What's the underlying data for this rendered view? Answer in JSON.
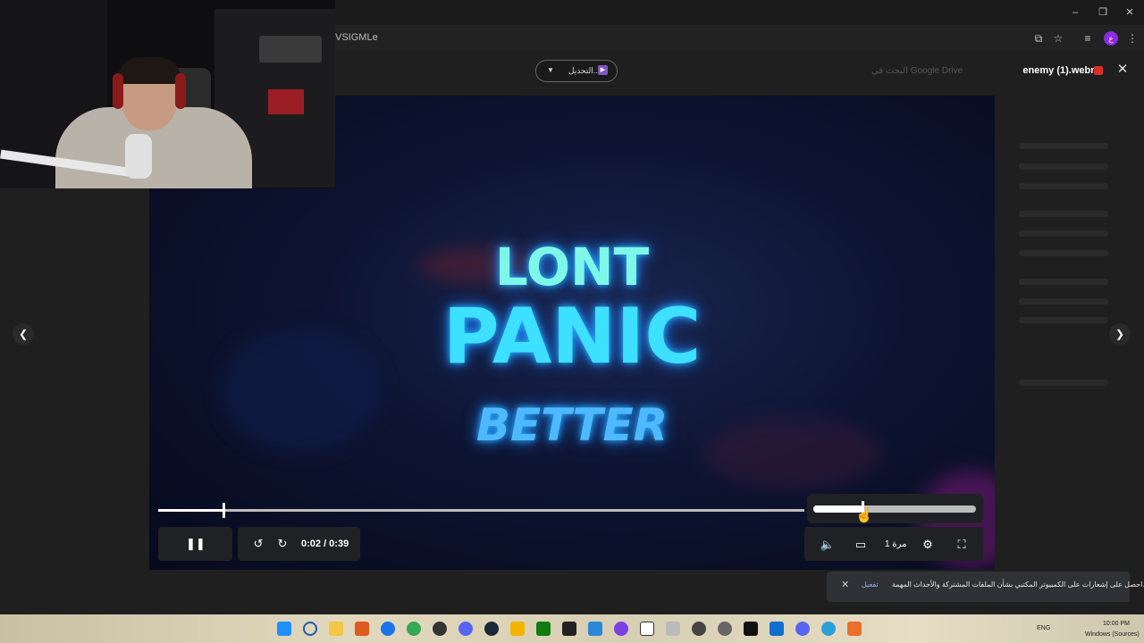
{
  "browser": {
    "address_fragment": "VSIGMLe",
    "profile_initial": "ع",
    "window_controls": [
      "minimize",
      "restore",
      "close"
    ]
  },
  "viewer": {
    "file_name": "enemy (1).webm",
    "open_with_label": "التحديل...",
    "search_placeholder": "البحث في Google Drive",
    "prev_icon": "chevron-left-icon",
    "next_icon": "chevron-right-icon"
  },
  "video": {
    "line1": "LONT",
    "line2": "PANIC",
    "line3": "BETTER"
  },
  "player": {
    "current_time": "0:02",
    "duration": "0:39",
    "time_label": "0:02 / 0:39",
    "progress_fraction": 0.05,
    "volume_fraction": 0.3,
    "speed_label": "1 مرة",
    "icons": [
      "pause-icon",
      "rewind-10-icon",
      "forward-10-icon",
      "volume-icon",
      "captions-icon",
      "settings-icon",
      "fullscreen-icon"
    ]
  },
  "toast": {
    "message": "احصل على إشعارات على الكمبيوتر المكتبي بشأن الملفات المشتركة والأحداث المهمة.",
    "action": "تفعيل"
  },
  "taskbar": {
    "lang": "ENG",
    "time": "10:00 PM",
    "date": "Windows (Sources)"
  }
}
